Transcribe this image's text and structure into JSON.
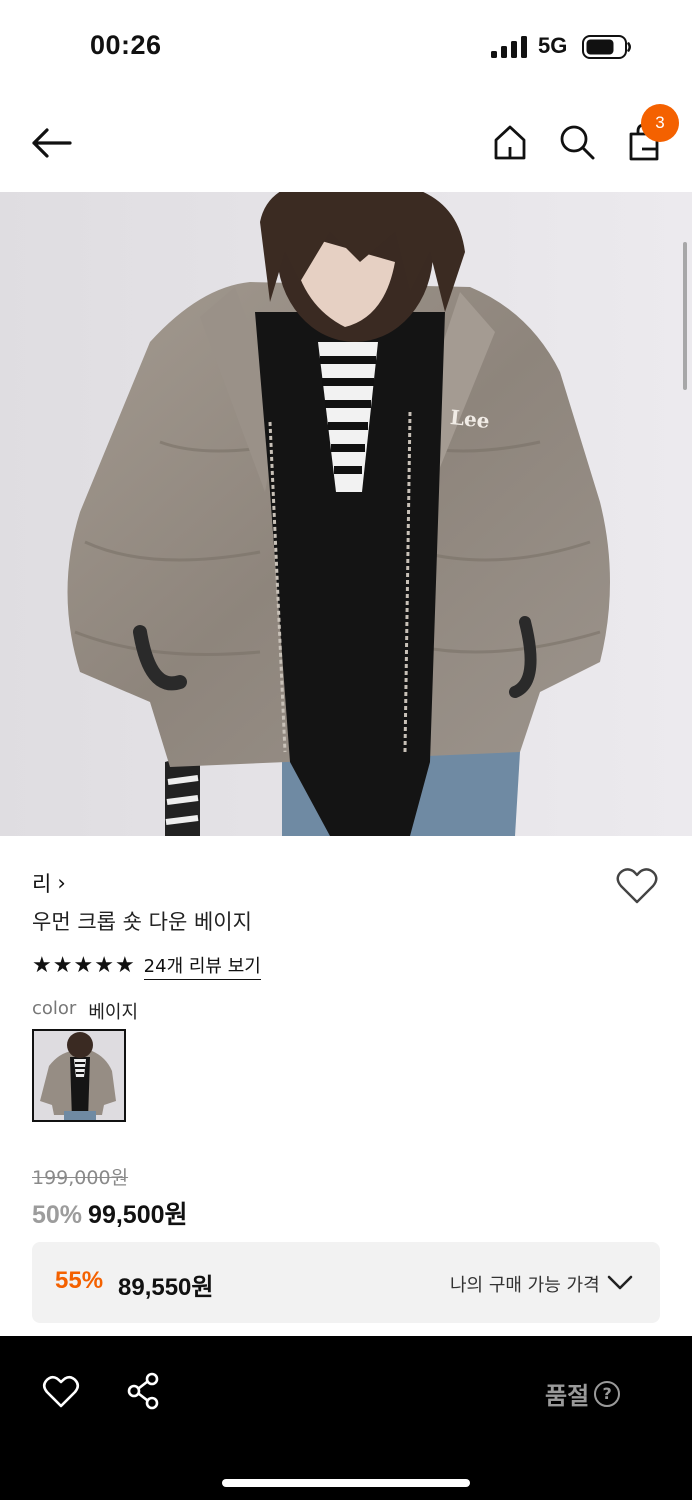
{
  "status": {
    "time": "00:26",
    "network": "5G"
  },
  "nav": {
    "cart_count": "3"
  },
  "product": {
    "brand": "리",
    "brand_chevron": "›",
    "title": "우먼 크롭 숏 다운 베이지",
    "rating_stars": 5,
    "review_link": "24개 리뷰 보기",
    "color_label": "color",
    "color_value": "베이지",
    "original_price": "199,000원",
    "discount": "50%",
    "sale_price": "99,500원"
  },
  "member_price": {
    "discount": "55%",
    "price": "89,550원",
    "label": "나의 구매 가능 가격"
  },
  "bottom_bar": {
    "soldout_label": "품절",
    "help_glyph": "?"
  },
  "colors": {
    "accent": "#f46100",
    "bottom_bar": "#000000",
    "member_box": "#f2f2f2"
  }
}
